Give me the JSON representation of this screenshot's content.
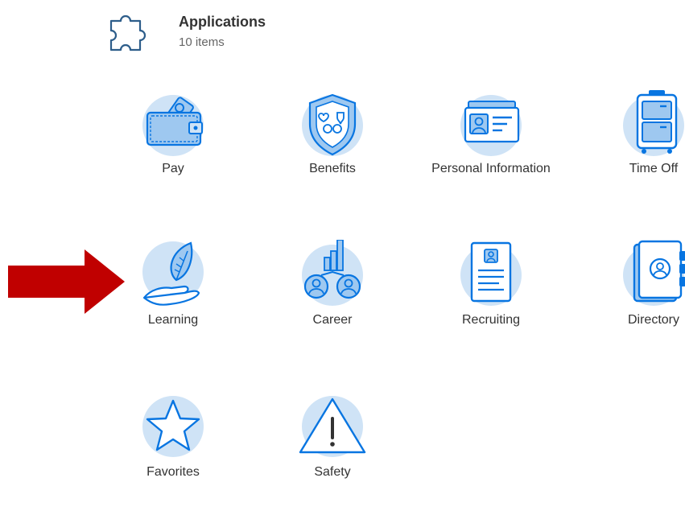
{
  "header": {
    "icon": "puzzle-piece-icon",
    "title": "Applications",
    "count": "10 items"
  },
  "apps": [
    {
      "label": "Pay",
      "icon": "wallet-icon"
    },
    {
      "label": "Benefits",
      "icon": "shield-icon"
    },
    {
      "label": "Personal Information",
      "icon": "id-card-icon"
    },
    {
      "label": "Time Off",
      "icon": "suitcase-icon"
    },
    {
      "label": "Learning",
      "icon": "hand-leaf-icon"
    },
    {
      "label": "Career",
      "icon": "career-people-icon"
    },
    {
      "label": "Recruiting",
      "icon": "resume-icon"
    },
    {
      "label": "Directory",
      "icon": "address-book-icon"
    },
    {
      "label": "Favorites",
      "icon": "star-icon"
    },
    {
      "label": "Safety",
      "icon": "warning-icon"
    }
  ],
  "annotation": {
    "icon": "red-arrow-icon",
    "color": "#c00000"
  },
  "colors": {
    "accent": "#0875e1",
    "icon_bg": "#cfe3f6",
    "icon_fill": "#9ec8f0"
  }
}
